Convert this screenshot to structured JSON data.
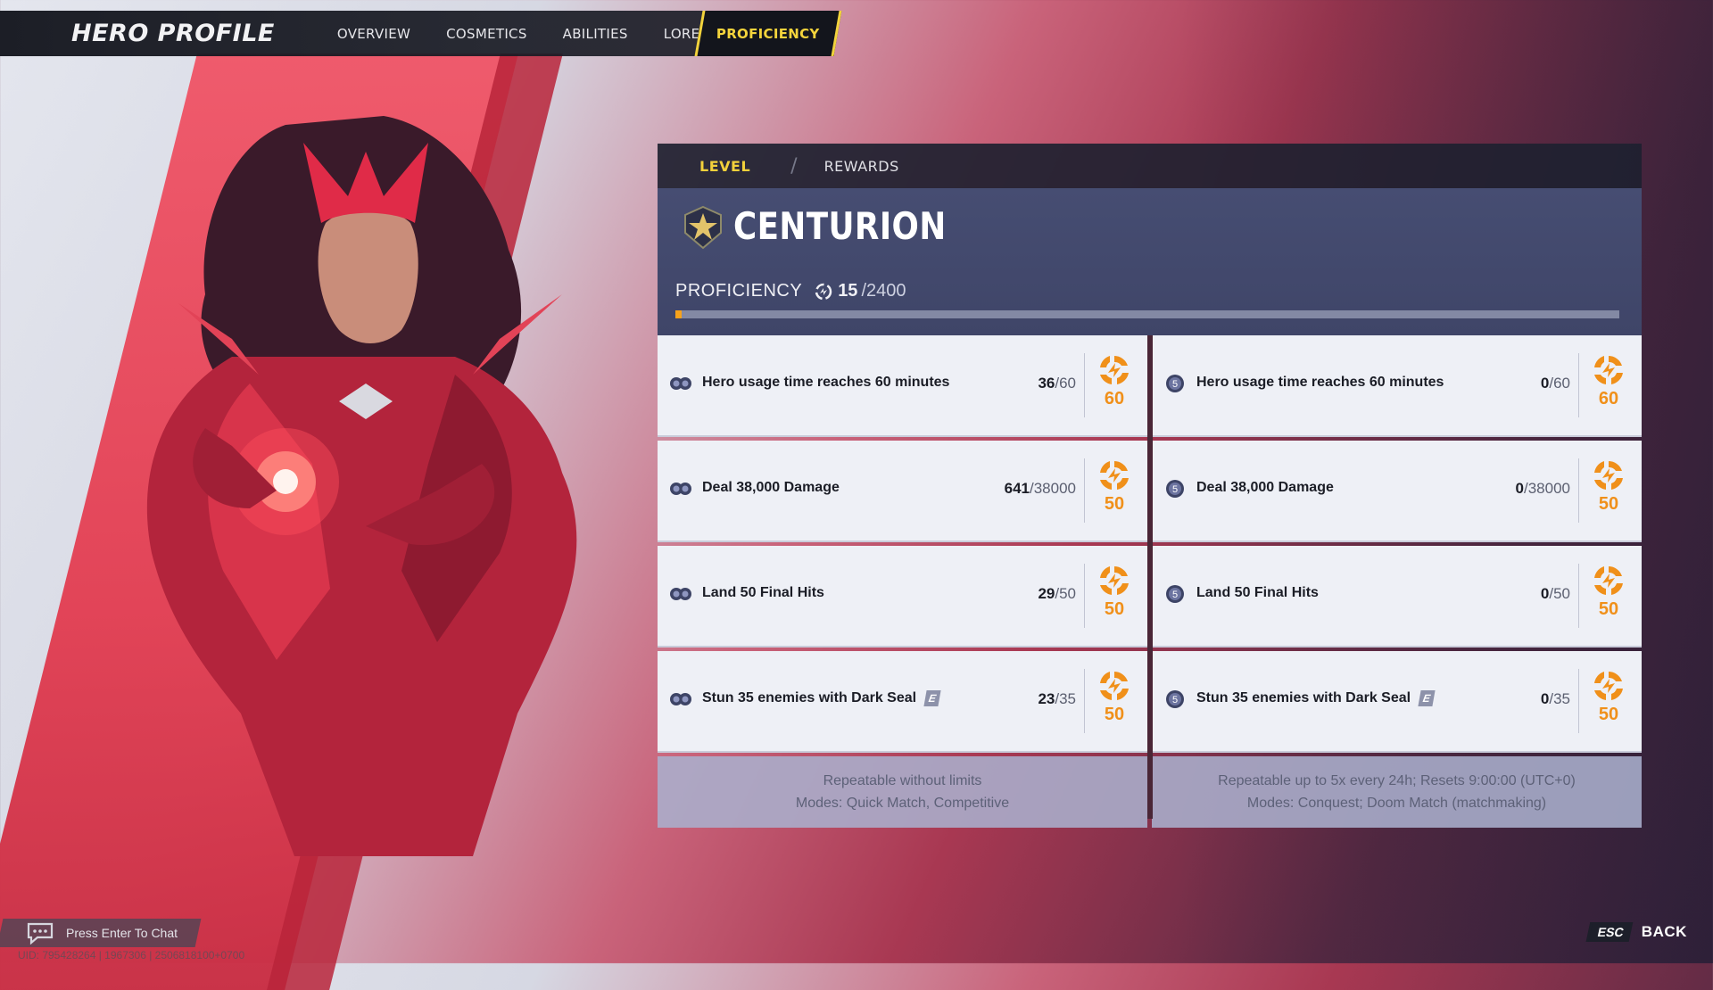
{
  "nav": {
    "title": "HERO PROFILE",
    "tabs": [
      "OVERVIEW",
      "COSMETICS",
      "ABILITIES",
      "LORE"
    ],
    "active_tab": "PROFICIENCY"
  },
  "subtabs": {
    "level": "LEVEL",
    "rewards": "REWARDS"
  },
  "rank": {
    "name": "CENTURION",
    "icon": "centurion-rank-icon"
  },
  "proficiency": {
    "label": "PROFICIENCY",
    "current": "15",
    "max": "/2400",
    "fraction": 0.00625
  },
  "colors": {
    "accent_yellow": "#f4d43c",
    "reward_orange": "#f0901a",
    "progress_orange": "#f7a21b",
    "panel_header": "#464d72"
  },
  "left_tasks": [
    {
      "text": "Hero usage time reaches 60 minutes",
      "current": "36",
      "max": "/60",
      "reward": "60",
      "has_key": false
    },
    {
      "text": "Deal 38,000 Damage",
      "current": "641",
      "max": "/38000",
      "reward": "50",
      "has_key": false
    },
    {
      "text": "Land 50 Final Hits",
      "current": "29",
      "max": "/50",
      "reward": "50",
      "has_key": false
    },
    {
      "text": "Stun 35 enemies with Dark Seal",
      "current": "23",
      "max": "/35",
      "reward": "50",
      "has_key": true,
      "key": "E"
    }
  ],
  "right_tasks": [
    {
      "text": "Hero usage time reaches 60 minutes",
      "current": "0",
      "max": "/60",
      "reward": "60",
      "has_key": false
    },
    {
      "text": "Deal 38,000 Damage",
      "current": "0",
      "max": "/38000",
      "reward": "50",
      "has_key": false
    },
    {
      "text": "Land 50 Final Hits",
      "current": "0",
      "max": "/50",
      "reward": "50",
      "has_key": false
    },
    {
      "text": "Stun 35 enemies with Dark Seal",
      "current": "0",
      "max": "/35",
      "reward": "50",
      "has_key": true,
      "key": "E"
    }
  ],
  "left_note": {
    "line1": "Repeatable without limits",
    "line2": "Modes: Quick Match, Competitive"
  },
  "right_note": {
    "line1": "Repeatable up to 5x every 24h; Resets 9:00:00 (UTC+0)",
    "line2": "Modes: Conquest; Doom Match (matchmaking)"
  },
  "chat": {
    "label": "Press Enter To Chat"
  },
  "uid": "UID: 795428264 | 1967306 | 2506818100+0700",
  "back": {
    "key": "ESC",
    "label": "BACK"
  }
}
